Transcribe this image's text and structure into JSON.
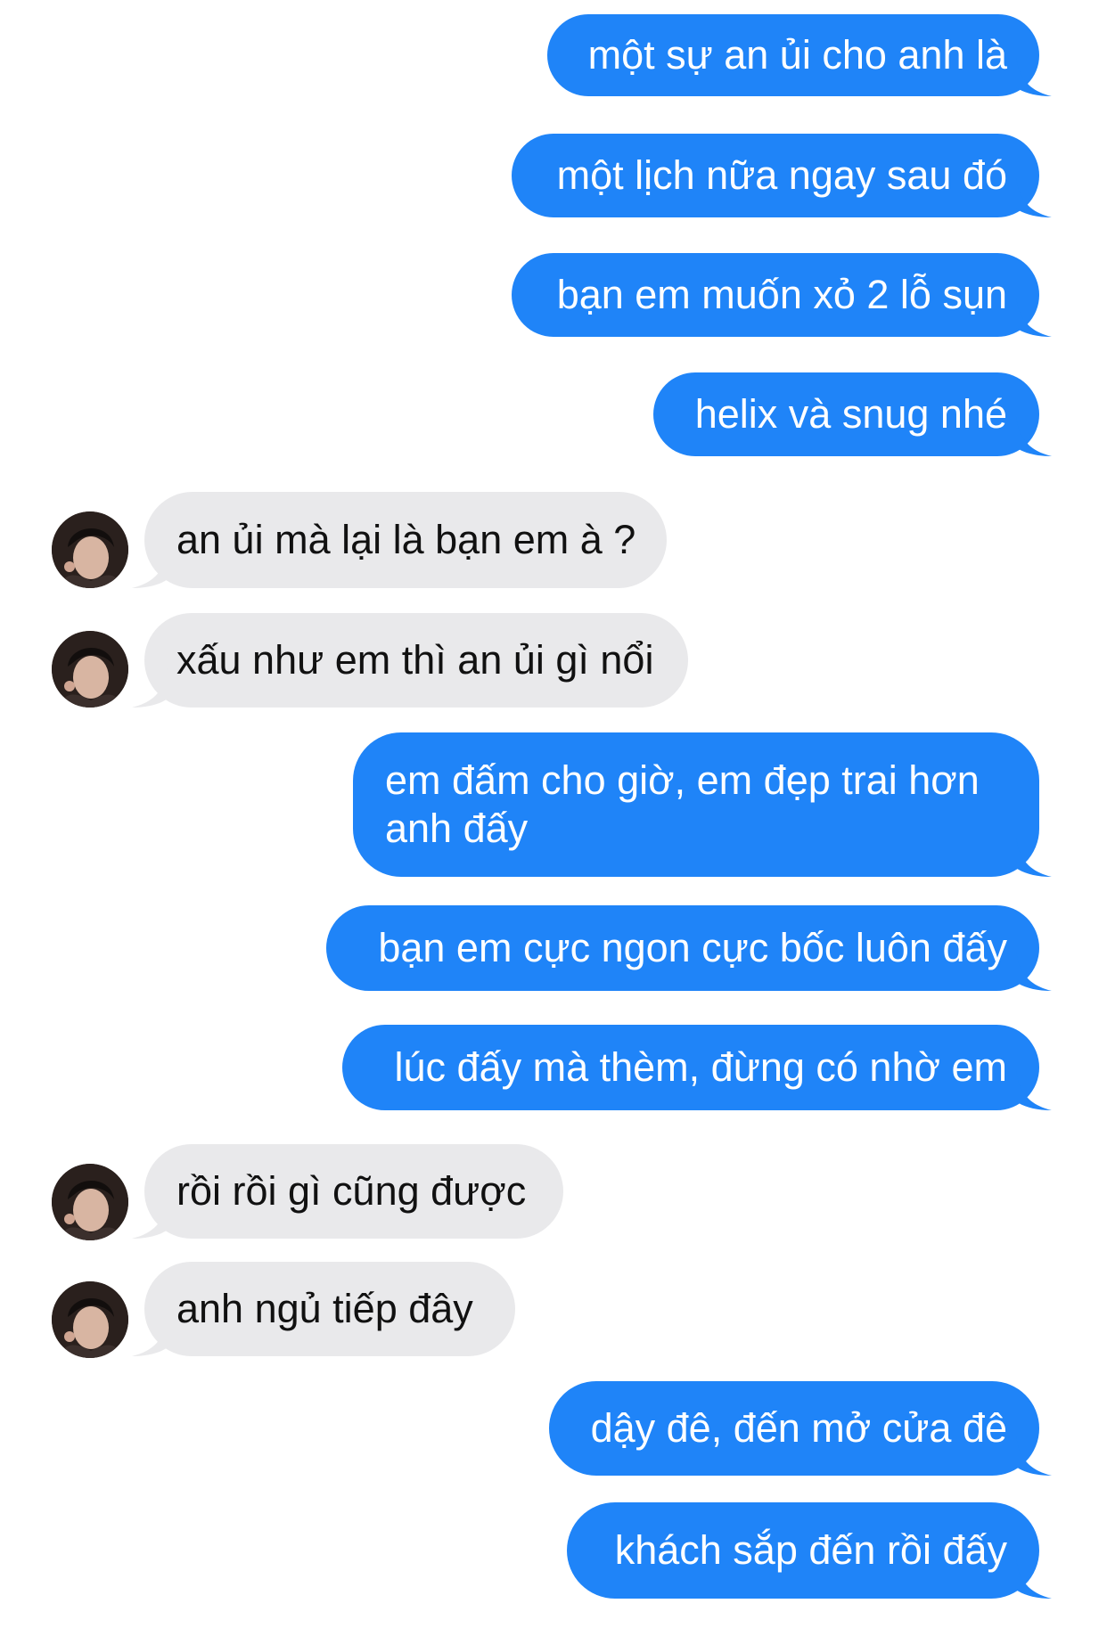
{
  "conversation": {
    "messages": [
      {
        "side": "sent",
        "text": "một sự an ủi cho anh là"
      },
      {
        "side": "sent",
        "text": "một lịch nữa ngay sau đó"
      },
      {
        "side": "sent",
        "text": "bạn em muốn xỏ 2 lỗ sụn"
      },
      {
        "side": "sent",
        "text": "helix và snug nhé"
      },
      {
        "side": "received",
        "text": "an ủi mà lại là bạn em à ?"
      },
      {
        "side": "received",
        "text": "xấu như em thì an ủi gì nổi"
      },
      {
        "side": "sent",
        "text": "em đấm cho giờ, em đẹp trai hơn anh đấy"
      },
      {
        "side": "sent",
        "text": "bạn em cực ngon cực bốc luôn đấy"
      },
      {
        "side": "sent",
        "text": "lúc đấy mà thèm, đừng có nhờ em"
      },
      {
        "side": "received",
        "text": "rồi rồi gì cũng được"
      },
      {
        "side": "received",
        "text": "anh ngủ tiếp đây"
      },
      {
        "side": "sent",
        "text": "dậy đê, đến mở cửa đê"
      },
      {
        "side": "sent",
        "text": "khách sắp đến rồi đấy"
      }
    ]
  },
  "colors": {
    "sent_bubble": "#1f84f8",
    "received_bubble": "#e9e9eb",
    "sent_text": "#ffffff",
    "received_text": "#111111"
  },
  "icons": {
    "contact_avatar": "contact-avatar-photo"
  }
}
